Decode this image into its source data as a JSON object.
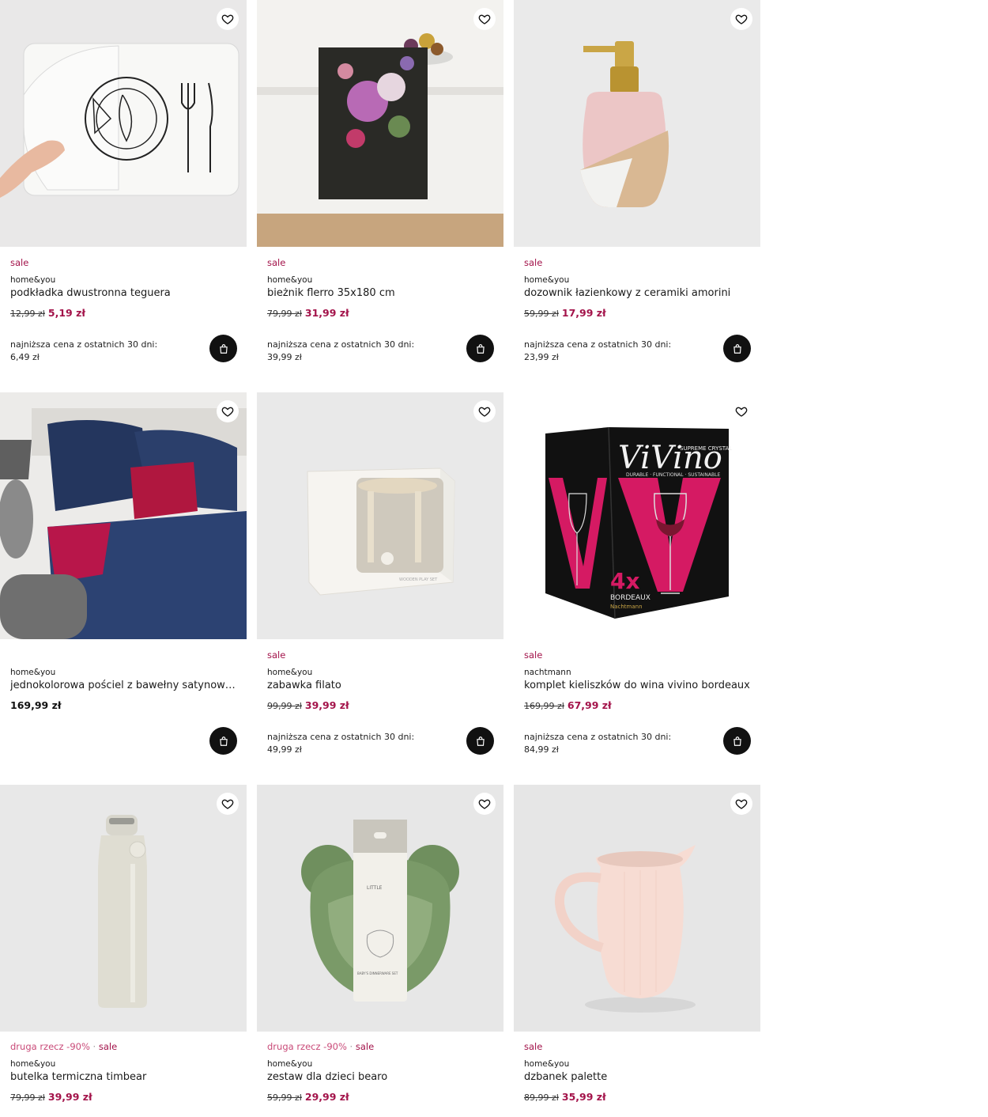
{
  "colors": {
    "sale": "#a3134a",
    "promo": "#c94a78",
    "cart": "#111111"
  },
  "products": [
    {
      "tag_promo": "",
      "tag_sale": "sale",
      "brand": "home&you",
      "name": "podkładka dwustronna teguera",
      "old_price": "12,99 zł",
      "price": "5,19 zł",
      "lowest_label": "najniższa cena z ostatnich 30 dni:",
      "lowest_value": "6,49 zł",
      "icon": "placemat-image"
    },
    {
      "tag_promo": "",
      "tag_sale": "sale",
      "brand": "home&you",
      "name": "bieżnik flerro 35x180 cm",
      "old_price": "79,99 zł",
      "price": "31,99 zł",
      "lowest_label": "najniższa cena z ostatnich 30 dni:",
      "lowest_value": "39,99 zł",
      "icon": "table-runner-image"
    },
    {
      "tag_promo": "",
      "tag_sale": "sale",
      "brand": "home&you",
      "name": "dozownik łazienkowy z ceramiki amorini",
      "old_price": "59,99 zł",
      "price": "17,99 zł",
      "lowest_label": "najniższa cena z ostatnich 30 dni:",
      "lowest_value": "23,99 zł",
      "icon": "soap-dispenser-image"
    },
    {
      "tag_promo": "",
      "tag_sale": "",
      "brand": "home&you",
      "name": "jednokolorowa pościel z bawełny satynowej...",
      "old_price": "",
      "price": "169,99 zł",
      "lowest_label": "",
      "lowest_value": "",
      "icon": "bedding-image"
    },
    {
      "tag_promo": "",
      "tag_sale": "sale",
      "brand": "home&you",
      "name": "zabawka filato",
      "old_price": "99,99 zł",
      "price": "39,99 zł",
      "lowest_label": "najniższa cena z ostatnich 30 dni:",
      "lowest_value": "49,99 zł",
      "icon": "toy-box-image"
    },
    {
      "tag_promo": "",
      "tag_sale": "sale",
      "brand": "nachtmann",
      "name": "komplet kieliszków do wina vivino bordeaux",
      "old_price": "169,99 zł",
      "price": "67,99 zł",
      "lowest_label": "najniższa cena z ostatnich 30 dni:",
      "lowest_value": "84,99 zł",
      "icon": "wine-glasses-box-image"
    },
    {
      "tag_promo": "druga rzecz -90%",
      "tag_sale": "sale",
      "brand": "home&you",
      "name": "butelka termiczna timbear",
      "old_price": "79,99 zł",
      "price": "39,99 zł",
      "lowest_label": "",
      "lowest_value": "",
      "icon": "thermal-bottle-image"
    },
    {
      "tag_promo": "druga rzecz -90%",
      "tag_sale": "sale",
      "brand": "home&you",
      "name": "zestaw dla dzieci bearo",
      "old_price": "59,99 zł",
      "price": "29,99 zł",
      "lowest_label": "",
      "lowest_value": "",
      "icon": "kids-dinnerware-image"
    },
    {
      "tag_promo": "",
      "tag_sale": "sale",
      "brand": "home&you",
      "name": "dzbanek palette",
      "old_price": "89,99 zł",
      "price": "35,99 zł",
      "lowest_label": "",
      "lowest_value": "",
      "icon": "jug-image"
    }
  ],
  "images": {
    "vivino_brand": "ViVino",
    "vivino_crystal": "SUPREME CRYSTAL",
    "vivino_tagline": "DURABLE · FUNCTIONAL · SUSTAINABLE",
    "vivino_count": "4x",
    "vivino_type": "BORDEAUX",
    "vivino_maker": "Nachtmann",
    "toy_box_text": "WOODEN PLAY SET",
    "kids_set_text1": "LITTLE",
    "kids_set_text2": "BABY'S DINNERWARE SET"
  }
}
